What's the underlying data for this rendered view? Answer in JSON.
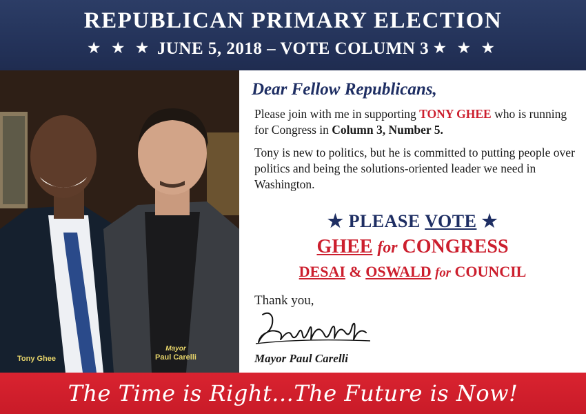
{
  "header": {
    "title": "REPUBLICAN PRIMARY ELECTION",
    "stars_left": "★ ★ ★",
    "subtitle": "JUNE 5, 2018 – VOTE COLUMN 3",
    "stars_right": "★ ★ ★"
  },
  "photo": {
    "caption_left": "Tony Ghee",
    "caption_right_role": "Mayor",
    "caption_right_name": "Paul Carelli"
  },
  "letter": {
    "greeting": "Dear Fellow Republicans,",
    "p1_a": "Please join with me in supporting ",
    "p1_name": "TONY GHEE",
    "p1_b": " who is running for Congress in ",
    "p1_col": "Column 3, Number 5.",
    "p2": "Tony is new to politics, but he is committed to putting people over politics and being the solutions-oriented leader we need in Washington.",
    "please_star_left": "★",
    "please_a": "PLEASE ",
    "please_vote": "VOTE",
    "please_star_right": "★",
    "line1_name": "GHEE",
    "line1_for": "for",
    "line1_office": "CONGRESS",
    "line2_name1": "DESAI",
    "line2_amp": "&",
    "line2_name2": "OSWALD",
    "line2_for": "for",
    "line2_office": "COUNCIL",
    "thanks": "Thank you,",
    "signature_text": "Paul M Carelli",
    "signer": "Mayor Paul Carelli"
  },
  "footer": {
    "slogan": "The Time is Right...The Future is Now!"
  },
  "colors": {
    "navy": "#24335a",
    "red": "#cc1f2e",
    "caption_gold": "#e6d46a"
  }
}
